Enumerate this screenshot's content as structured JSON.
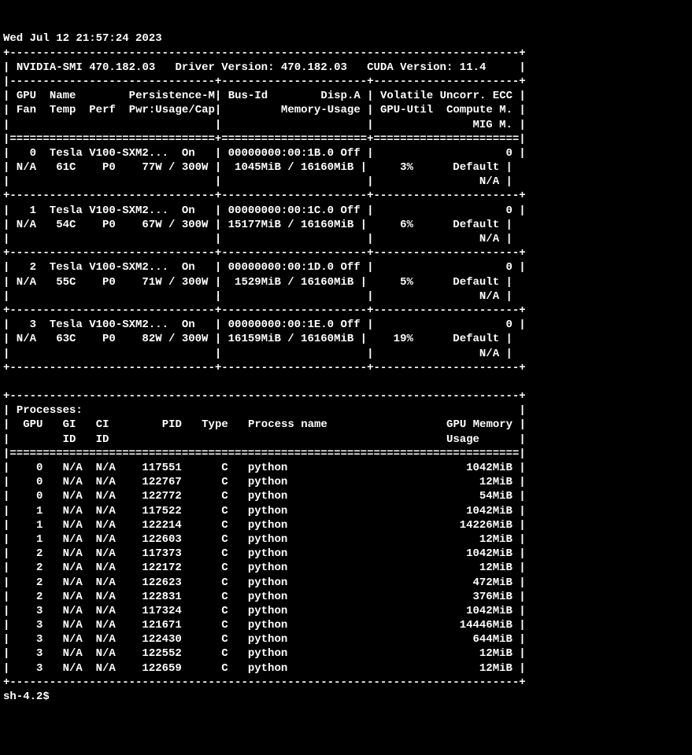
{
  "timestamp": "Wed Jul 12 21:57:24 2023",
  "header": {
    "smi_version": "NVIDIA-SMI 470.182.03",
    "driver_version": "Driver Version: 470.182.03",
    "cuda_version": "CUDA Version: 11.4"
  },
  "columns": {
    "row1": {
      "gpu": "GPU",
      "name": "Name",
      "persistence": "Persistence-M",
      "bus_id": "Bus-Id",
      "disp_a": "Disp.A",
      "volatile": "Volatile Uncorr. ECC"
    },
    "row2": {
      "fan": "Fan",
      "temp": "Temp",
      "perf": "Perf",
      "pwr": "Pwr:Usage/Cap",
      "memory": "Memory-Usage",
      "gpu_util": "GPU-Util",
      "compute": "Compute M."
    },
    "row3": {
      "mig": "MIG M."
    }
  },
  "gpus": [
    {
      "id": "0",
      "name": "Tesla V100-SXM2...",
      "persistence": "On",
      "bus_id": "00000000:00:1B.0",
      "disp_a": "Off",
      "ecc": "0",
      "fan": "N/A",
      "temp": "61C",
      "perf": "P0",
      "pwr_usage": "77W",
      "pwr_cap": "300W",
      "mem_used": "1045MiB",
      "mem_total": "16160MiB",
      "gpu_util": "3%",
      "compute": "Default",
      "mig": "N/A"
    },
    {
      "id": "1",
      "name": "Tesla V100-SXM2...",
      "persistence": "On",
      "bus_id": "00000000:00:1C.0",
      "disp_a": "Off",
      "ecc": "0",
      "fan": "N/A",
      "temp": "54C",
      "perf": "P0",
      "pwr_usage": "67W",
      "pwr_cap": "300W",
      "mem_used": "15177MiB",
      "mem_total": "16160MiB",
      "gpu_util": "6%",
      "compute": "Default",
      "mig": "N/A"
    },
    {
      "id": "2",
      "name": "Tesla V100-SXM2...",
      "persistence": "On",
      "bus_id": "00000000:00:1D.0",
      "disp_a": "Off",
      "ecc": "0",
      "fan": "N/A",
      "temp": "55C",
      "perf": "P0",
      "pwr_usage": "71W",
      "pwr_cap": "300W",
      "mem_used": "1529MiB",
      "mem_total": "16160MiB",
      "gpu_util": "5%",
      "compute": "Default",
      "mig": "N/A"
    },
    {
      "id": "3",
      "name": "Tesla V100-SXM2...",
      "persistence": "On",
      "bus_id": "00000000:00:1E.0",
      "disp_a": "Off",
      "ecc": "0",
      "fan": "N/A",
      "temp": "63C",
      "perf": "P0",
      "pwr_usage": "82W",
      "pwr_cap": "300W",
      "mem_used": "16159MiB",
      "mem_total": "16160MiB",
      "gpu_util": "19%",
      "compute": "Default",
      "mig": "N/A"
    }
  ],
  "processes": {
    "title": "Processes:",
    "headers": {
      "gpu": "GPU",
      "gi": "GI",
      "ci": "CI",
      "pid": "PID",
      "type": "Type",
      "name": "Process name",
      "memory": "GPU Memory",
      "gi_sub": "ID",
      "ci_sub": "ID",
      "mem_sub": "Usage"
    },
    "rows": [
      {
        "gpu": "0",
        "gi": "N/A",
        "ci": "N/A",
        "pid": "117551",
        "type": "C",
        "name": "python",
        "memory": "1042MiB"
      },
      {
        "gpu": "0",
        "gi": "N/A",
        "ci": "N/A",
        "pid": "122767",
        "type": "C",
        "name": "python",
        "memory": "12MiB"
      },
      {
        "gpu": "0",
        "gi": "N/A",
        "ci": "N/A",
        "pid": "122772",
        "type": "C",
        "name": "python",
        "memory": "54MiB"
      },
      {
        "gpu": "1",
        "gi": "N/A",
        "ci": "N/A",
        "pid": "117522",
        "type": "C",
        "name": "python",
        "memory": "1042MiB"
      },
      {
        "gpu": "1",
        "gi": "N/A",
        "ci": "N/A",
        "pid": "122214",
        "type": "C",
        "name": "python",
        "memory": "14226MiB"
      },
      {
        "gpu": "1",
        "gi": "N/A",
        "ci": "N/A",
        "pid": "122603",
        "type": "C",
        "name": "python",
        "memory": "12MiB"
      },
      {
        "gpu": "2",
        "gi": "N/A",
        "ci": "N/A",
        "pid": "117373",
        "type": "C",
        "name": "python",
        "memory": "1042MiB"
      },
      {
        "gpu": "2",
        "gi": "N/A",
        "ci": "N/A",
        "pid": "122172",
        "type": "C",
        "name": "python",
        "memory": "12MiB"
      },
      {
        "gpu": "2",
        "gi": "N/A",
        "ci": "N/A",
        "pid": "122623",
        "type": "C",
        "name": "python",
        "memory": "472MiB"
      },
      {
        "gpu": "2",
        "gi": "N/A",
        "ci": "N/A",
        "pid": "122831",
        "type": "C",
        "name": "python",
        "memory": "376MiB"
      },
      {
        "gpu": "3",
        "gi": "N/A",
        "ci": "N/A",
        "pid": "117324",
        "type": "C",
        "name": "python",
        "memory": "1042MiB"
      },
      {
        "gpu": "3",
        "gi": "N/A",
        "ci": "N/A",
        "pid": "121671",
        "type": "C",
        "name": "python",
        "memory": "14446MiB"
      },
      {
        "gpu": "3",
        "gi": "N/A",
        "ci": "N/A",
        "pid": "122430",
        "type": "C",
        "name": "python",
        "memory": "644MiB"
      },
      {
        "gpu": "3",
        "gi": "N/A",
        "ci": "N/A",
        "pid": "122552",
        "type": "C",
        "name": "python",
        "memory": "12MiB"
      },
      {
        "gpu": "3",
        "gi": "N/A",
        "ci": "N/A",
        "pid": "122659",
        "type": "C",
        "name": "python",
        "memory": "12MiB"
      }
    ]
  },
  "prompt": "sh-4.2$ "
}
